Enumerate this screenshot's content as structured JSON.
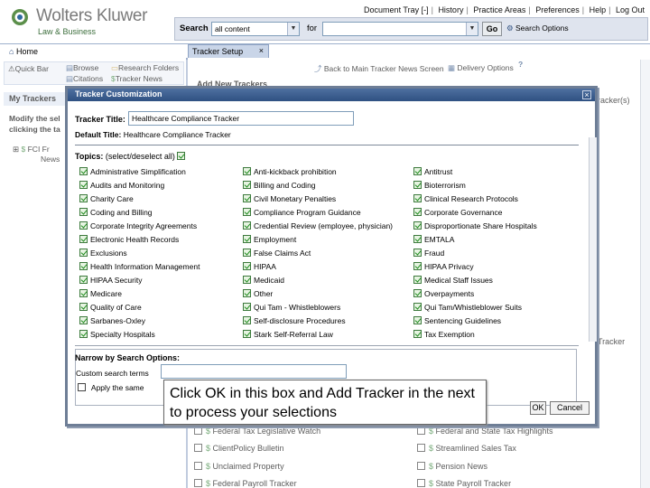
{
  "brand": {
    "name": "Wolters Kluwer",
    "subtitle": "Law & Business"
  },
  "top_links": [
    "Document Tray [-]",
    "History",
    "Practice Areas",
    "Preferences",
    "Help",
    "Log Out"
  ],
  "search": {
    "label": "Search",
    "scope": "all content",
    "for_label": "for",
    "query": "",
    "go": "Go",
    "options": "Search Options"
  },
  "nav": {
    "home": "Home",
    "browse": "Browse",
    "research_folders": "Research Folders",
    "quick_bar": "Quick Bar",
    "citations": "Citations",
    "tracker_news": "Tracker News",
    "tracker_setup_tab": "Tracker Setup"
  },
  "left": {
    "my_trackers": "My Trackers",
    "modify_text_1": "Modify the sel",
    "modify_text_2": "clicking the ta",
    "item_1": "FCI Fr",
    "item_2": "News"
  },
  "actions": {
    "back": "Back to Main Tracker News Screen",
    "delivery": "Delivery Options"
  },
  "main_behind": {
    "add_new": "Add New Trackers",
    "trackers_suffix": "racker(s)",
    "tracker_suffix2": "Tracker"
  },
  "background_rows": [
    {
      "left": "Federal Tax Legislative Watch",
      "right": "Federal and State Tax Highlights"
    },
    {
      "left": "ClientPolicy Bulletin",
      "right": "Streamlined Sales Tax"
    },
    {
      "left": "Unclaimed Property",
      "right": "Pension News"
    },
    {
      "left": "Federal Payroll Tracker",
      "right": "State Payroll Tracker"
    }
  ],
  "modal": {
    "title": "Tracker Customization",
    "tracker_title_label": "Tracker Title:",
    "tracker_title_value": "Healthcare Compliance Tracker",
    "default_title_label": "Default Title:",
    "default_title_value": "Healthcare Compliance Tracker",
    "topics_label": "Topics:",
    "select_deselect": "(select/deselect all)",
    "topics": [
      [
        "Administrative Simplification",
        "Anti-kickback prohibition",
        "Antitrust"
      ],
      [
        "Audits and Monitoring",
        "Billing and Coding",
        "Bioterrorism"
      ],
      [
        "Charity Care",
        "Civil Monetary Penalties",
        "Clinical Research Protocols"
      ],
      [
        "Coding and Billing",
        "Compliance Program Guidance",
        "Corporate Governance"
      ],
      [
        "Corporate Integrity Agreements",
        "Credential Review (employee, physician)",
        "Disproportionate Share Hospitals"
      ],
      [
        "Electronic Health Records",
        "Employment",
        "EMTALA"
      ],
      [
        "Exclusions",
        "False Claims Act",
        "Fraud"
      ],
      [
        "Health Information Management",
        "HIPAA",
        "HIPAA Privacy"
      ],
      [
        "HIPAA Security",
        "Medicaid",
        "Medical Staff Issues"
      ],
      [
        "Medicare",
        "Other",
        "Overpayments"
      ],
      [
        "Quality of Care",
        "Qui Tam - Whistleblowers",
        "Qui Tam/Whistleblower Suits"
      ],
      [
        "Sarbanes-Oxley",
        "Self-disclosure Procedures",
        "Sentencing Guidelines"
      ],
      [
        "Specialty Hospitals",
        "Stark Self-Referral Law",
        "Tax Exemption"
      ]
    ],
    "narrow_label": "Narrow by Search Options:",
    "custom_terms_label": "Custom search terms",
    "apply_label": "Apply the same",
    "ok": "OK",
    "cancel": "Cancel"
  },
  "callout": "Click OK in this box and Add Tracker in the next to process your selections",
  "colors": {
    "accent": "#2f5182",
    "check": "#1c8a1c",
    "brand_green": "#3b6d3b"
  }
}
